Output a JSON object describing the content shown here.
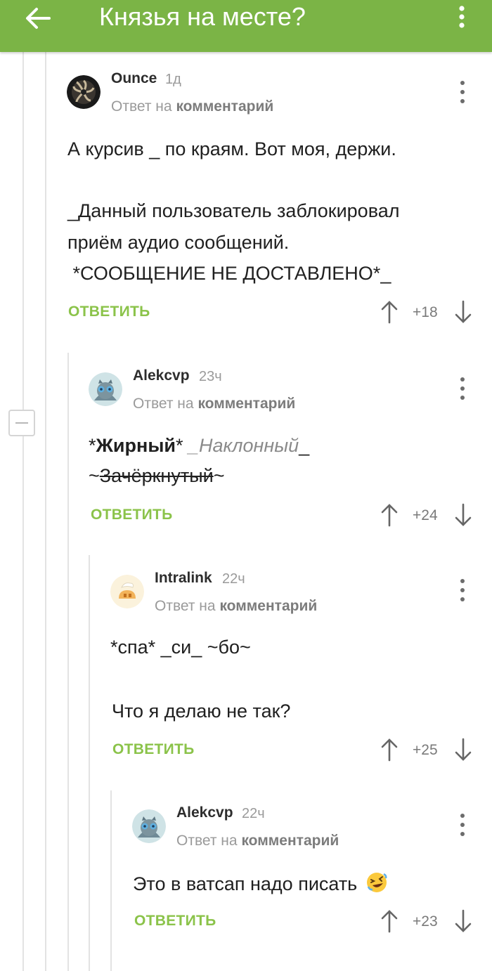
{
  "header": {
    "title": "Князья на месте?",
    "background": "#7bb446",
    "back_icon": "arrow-left-icon",
    "menu_icon": "more-vertical-icon"
  },
  "reply_label_prefix": "Ответ на",
  "reply_label_target": "комментарий",
  "reply_button_label": "ОТВЕТИТЬ",
  "accent_color": "#8bc34a",
  "comments": [
    {
      "author": "Ounce",
      "time": "1д",
      "reply_prefix": "Ответ на",
      "reply_target": "комментарий",
      "body": [
        "А курсив _ по краям. Вот моя, держи.",
        "",
        "_Данный пользователь заблокировал",
        "приём аудио сообщений.",
        " *СООБЩЕНИЕ НЕ ДОСТАВЛЕНО*_"
      ],
      "reply_label": "ОТВЕТИТЬ",
      "rating": "+18"
    },
    {
      "author": "Alekcvp",
      "time": "23ч",
      "reply_prefix": "Ответ на",
      "reply_target": "комментарий",
      "body_parts": {
        "bold_open": "*",
        "bold_text": "Жирный",
        "bold_close": "*",
        "italic_open": "_",
        "italic_text": "Наклонный",
        "italic_close": "_",
        "strike_open": "~",
        "strike_text": "Зачёркнутый",
        "strike_close": "~"
      },
      "reply_label": "ОТВЕТИТЬ",
      "rating": "+24"
    },
    {
      "author": "Intralink",
      "time": "22ч",
      "reply_prefix": "Ответ на",
      "reply_target": "комментарий",
      "body": [
        "*спа* _си_ ~бо~",
        "",
        "Что я делаю не так?"
      ],
      "reply_label": "ОТВЕТИТЬ",
      "rating": "+25"
    },
    {
      "author": "Alekcvp",
      "time": "22ч",
      "reply_prefix": "Ответ на",
      "reply_target": "комментарий",
      "body": [
        "Это в ватсап надо писать"
      ],
      "emoji": "rolling-on-floor-laughing-emoji",
      "reply_label": "ОТВЕТИТЬ",
      "rating": "+23"
    }
  ]
}
